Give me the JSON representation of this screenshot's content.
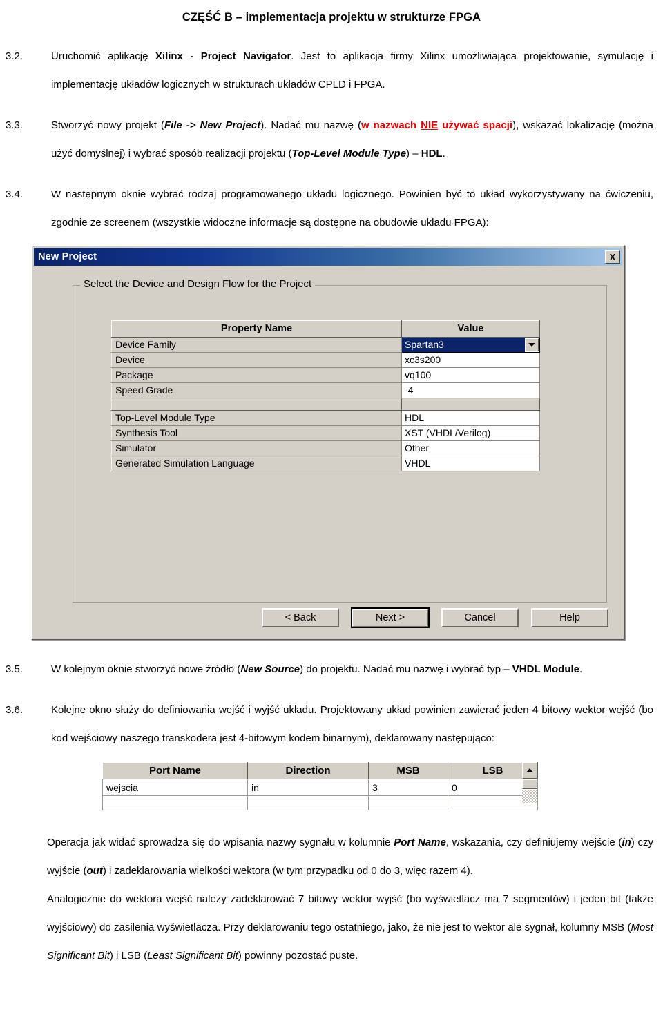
{
  "document": {
    "title": "CZĘŚĆ B – implementacja projektu w strukturze FPGA"
  },
  "steps": [
    {
      "number": "3.2.",
      "segments": [
        {
          "text": "Uruchomić aplikację ",
          "style": "normal"
        },
        {
          "text": "Xilinx - Project Navigator",
          "style": "bold"
        },
        {
          "text": ". Jest to aplikacja firmy Xilinx umożliwiająca projektowanie, symulację i implementację układów logicznych w strukturach układów CPLD i FPGA.",
          "style": "normal"
        }
      ]
    },
    {
      "number": "3.3.",
      "segments": [
        {
          "text": "Stworzyć nowy projekt (",
          "style": "normal"
        },
        {
          "text": "File -> New Project",
          "style": "bold-italic"
        },
        {
          "text": "). Nadać mu nazwę (",
          "style": "normal"
        },
        {
          "text": "w nazwach ",
          "style": "red-bold"
        },
        {
          "text": "NIE",
          "style": "red-bold-underline"
        },
        {
          "text": " używać spacji",
          "style": "red-bold"
        },
        {
          "text": "), wskazać lokalizację (można użyć domyślnej) i wybrać sposób realizacji projektu (",
          "style": "normal"
        },
        {
          "text": "Top-Level Module Type",
          "style": "bold-italic"
        },
        {
          "text": ") – ",
          "style": "normal"
        },
        {
          "text": "HDL",
          "style": "bold"
        },
        {
          "text": ".",
          "style": "normal"
        }
      ]
    },
    {
      "number": "3.4.",
      "segments": [
        {
          "text": "W następnym oknie wybrać rodzaj programowanego układu logicznego. Powinien być to układ wykorzystywany na ćwiczeniu, zgodnie ze screenem (wszystkie widoczne informacje są dostępne na obudowie układu FPGA):",
          "style": "normal"
        }
      ]
    },
    {
      "number": "3.5.",
      "segments": [
        {
          "text": "W kolejnym oknie stworzyć nowe źródło (",
          "style": "normal"
        },
        {
          "text": "New Source",
          "style": "bold-italic"
        },
        {
          "text": ") do projektu. Nadać mu nazwę i wybrać typ – ",
          "style": "normal"
        },
        {
          "text": "VHDL Module",
          "style": "bold"
        },
        {
          "text": ".",
          "style": "normal"
        }
      ]
    },
    {
      "number": "3.6.",
      "segments": [
        {
          "text": "Kolejne okno służy do definiowania wejść i wyjść układu. Projektowany układ powinien zawierać jeden 4 bitowy wektor wejść (bo kod wejściowy naszego transkodera jest 4-bitowym kodem binarnym), deklarowany następująco:",
          "style": "normal"
        }
      ]
    }
  ],
  "dialog": {
    "title": "New Project",
    "close_label": "X",
    "groupbox_legend": "Select the Device and Design Flow for the Project",
    "grid": {
      "headers": [
        "Property Name",
        "Value"
      ],
      "rows": [
        {
          "name": "Device Family",
          "value": "Spartan3",
          "control": "combo-selected"
        },
        {
          "name": "Device",
          "value": "xc3s200",
          "control": "text"
        },
        {
          "name": "Package",
          "value": "vq100",
          "control": "text"
        },
        {
          "name": "Speed Grade",
          "value": "-4",
          "control": "text"
        },
        {
          "name": "",
          "value": "",
          "control": "spacer"
        },
        {
          "name": "Top-Level Module Type",
          "value": "HDL",
          "control": "text"
        },
        {
          "name": "Synthesis Tool",
          "value": "XST (VHDL/Verilog)",
          "control": "text"
        },
        {
          "name": "Simulator",
          "value": "Other",
          "control": "text"
        },
        {
          "name": "Generated Simulation Language",
          "value": "VHDL",
          "control": "text"
        }
      ]
    },
    "buttons": [
      {
        "label": "< Back",
        "default": false
      },
      {
        "label": "Next >",
        "default": true
      },
      {
        "label": "Cancel",
        "default": false
      },
      {
        "label": "Help",
        "default": false
      }
    ],
    "colors": {
      "face": "#d4d0c8",
      "title_start": "#0a246a",
      "title_end": "#a6c8e8",
      "selection": "#0a246a"
    }
  },
  "port_table": {
    "headers": [
      "Port Name",
      "Direction",
      "MSB",
      "LSB"
    ],
    "rows": [
      {
        "port_name": "wejscia",
        "direction": "in",
        "msb": "3",
        "lsb": "0"
      }
    ]
  },
  "closing": {
    "p1": [
      {
        "text": "Operacja jak widać sprowadza się do wpisania nazwy sygnału w kolumnie ",
        "style": "normal"
      },
      {
        "text": "Port Name",
        "style": "bold-italic"
      },
      {
        "text": ", wskazania, czy definiujemy wejście (",
        "style": "normal"
      },
      {
        "text": "in",
        "style": "bold-italic"
      },
      {
        "text": ") czy wyjście (",
        "style": "normal"
      },
      {
        "text": "out",
        "style": "bold-italic"
      },
      {
        "text": ") i zadeklarowania wielkości wektora (w tym przypadku od 0 do 3, więc razem 4).",
        "style": "normal"
      }
    ],
    "p2": [
      {
        "text": "Analogicznie do wektora wejść należy zadeklarować 7 bitowy wektor wyjść (bo wyświetlacz ma 7 segmentów) i jeden bit (także wyjściowy) do zasilenia wyświetlacza. Przy deklarowaniu tego ostatniego, jako, że nie jest to wektor ale sygnał, kolumny MSB (",
        "style": "normal"
      },
      {
        "text": "Most Significant Bit",
        "style": "italic"
      },
      {
        "text": ") i LSB (",
        "style": "normal"
      },
      {
        "text": "Least Significant Bit",
        "style": "italic"
      },
      {
        "text": ") powinny pozostać puste.",
        "style": "normal"
      }
    ]
  }
}
